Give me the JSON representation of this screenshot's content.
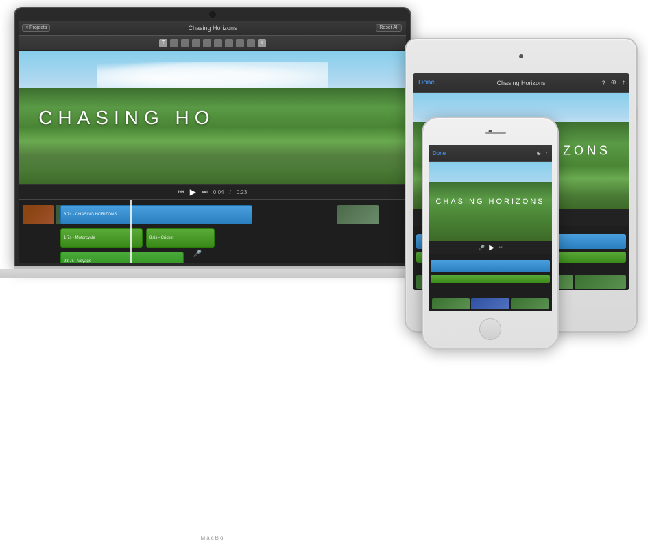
{
  "scene": {
    "bg_color": "#ffffff"
  },
  "macbook": {
    "title": "Chasing Horizons",
    "toolbar": {
      "projects_label": "< Projects",
      "reset_label": "Reset All"
    },
    "preview": {
      "title_text": "CHASING HO"
    },
    "controls": {
      "time_current": "0:04",
      "time_total": "0:23"
    },
    "timeline": {
      "track_labels": {
        "blue": "3.7s - CHASING HORIZONS",
        "green1": "1.7s - Motorcycle",
        "green2": "8.6s - Cricket",
        "green3": "23.7s - Voyage"
      }
    },
    "logo_text": "MacBo"
  },
  "ipad": {
    "toolbar": {
      "done_label": "Done",
      "title": "Chasing Horizons"
    },
    "preview": {
      "title_text": "CHASING HORIZONS"
    }
  },
  "iphone": {
    "toolbar": {
      "done_label": "Done"
    },
    "preview": {
      "title_text": "CHASING HORIZONS"
    }
  }
}
